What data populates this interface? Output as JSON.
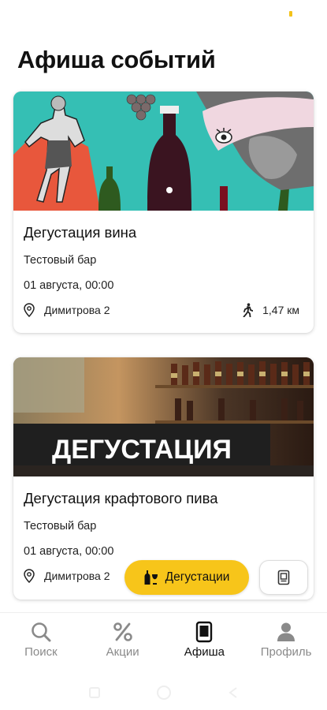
{
  "page": {
    "title": "Афиша событий"
  },
  "events": [
    {
      "title": "Дегустация вина",
      "venue": "Тестовый бар",
      "date": "01 августа, 00:00",
      "address": "Димитрова 2",
      "distance": "1,47 км"
    },
    {
      "title": "Дегустация крафтового пива",
      "venue": "Тестовый бар",
      "date": "01 августа, 00:00",
      "address": "Димитрова 2",
      "banner_text": "ДЕГУСТАЦИЯ"
    }
  ],
  "filter_chip": {
    "label": "Дегустации"
  },
  "bottom_nav": [
    {
      "label": "Поиск",
      "icon": "search-icon"
    },
    {
      "label": "Акции",
      "icon": "percent-icon"
    },
    {
      "label": "Афиша",
      "icon": "poster-icon",
      "active": true
    },
    {
      "label": "Профиль",
      "icon": "profile-icon"
    }
  ],
  "colors": {
    "accent": "#f7c51a",
    "teal": "#35bfb4"
  }
}
